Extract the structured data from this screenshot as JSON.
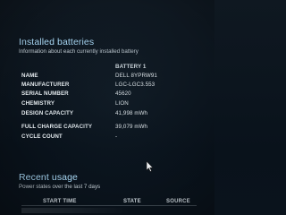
{
  "installed": {
    "title": "Installed batteries",
    "subtitle": "Information about each currently installed battery",
    "column_header": "BATTERY 1",
    "rows": [
      {
        "label": "NAME",
        "value": "DELL 8YPRW91"
      },
      {
        "label": "MANUFACTURER",
        "value": "LGC-LGC3.553"
      },
      {
        "label": "SERIAL NUMBER",
        "value": "45620"
      },
      {
        "label": "CHEMISTRY",
        "value": "LION"
      },
      {
        "label": "DESIGN CAPACITY",
        "value": "41,998 mWh"
      },
      {
        "label": "FULL CHARGE CAPACITY",
        "value": "39,079 mWh"
      },
      {
        "label": "CYCLE COUNT",
        "value": "-"
      }
    ]
  },
  "recent_usage": {
    "title": "Recent usage",
    "subtitle": "Power states over the last 7 days",
    "columns": [
      "START TIME",
      "STATE",
      "SOURCE"
    ]
  },
  "icons": {
    "cursor": "mouse-pointer-icon"
  },
  "colors": {
    "background": "#0c151e",
    "heading": "#a9d8f5",
    "text": "#e8eef2"
  }
}
